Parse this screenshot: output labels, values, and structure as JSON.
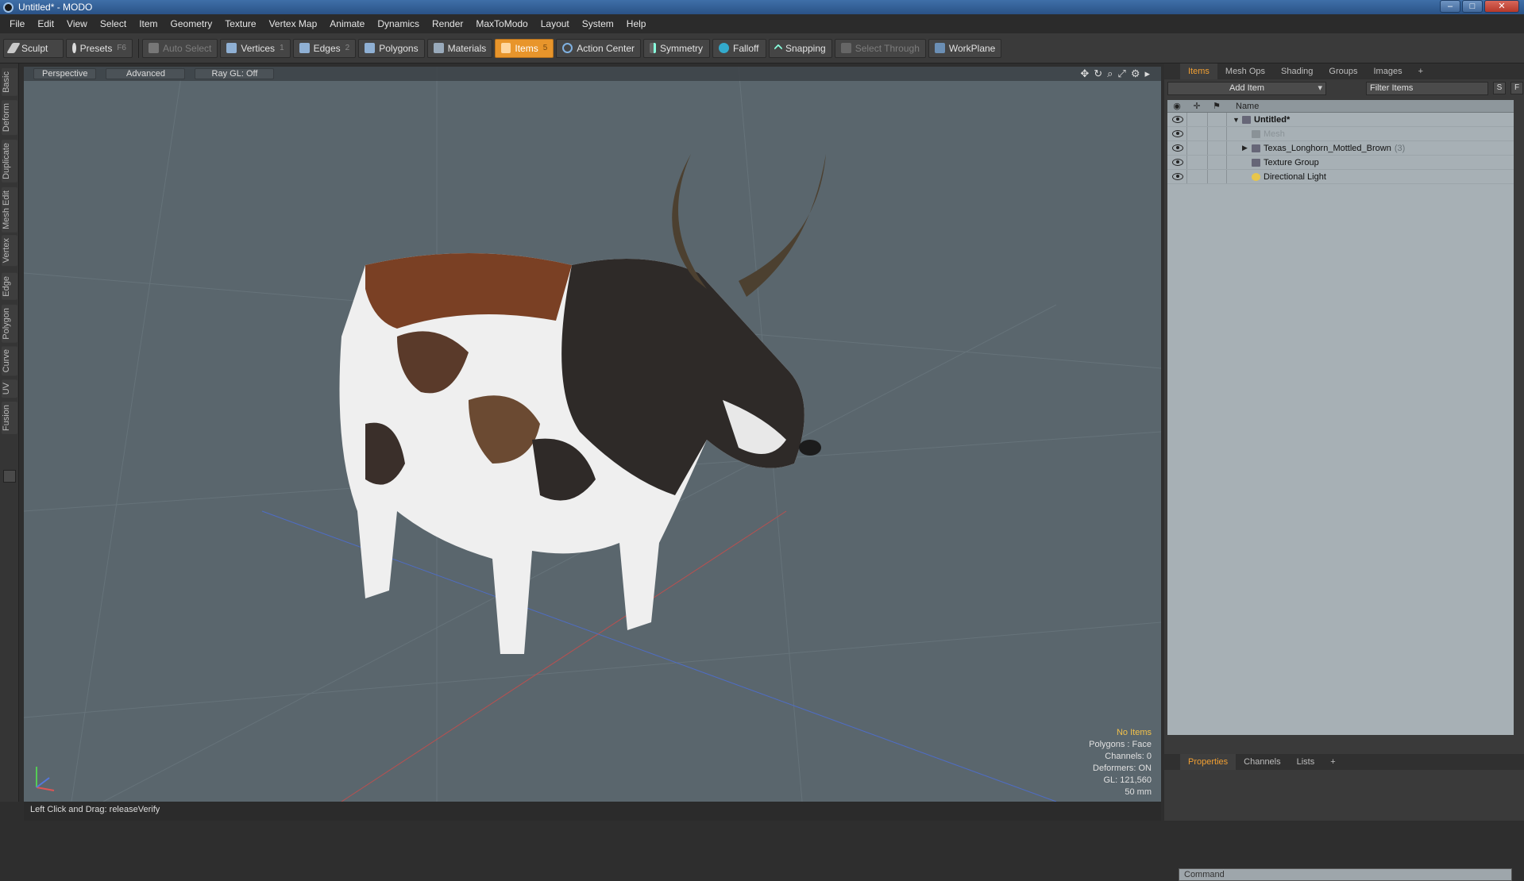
{
  "window": {
    "title": "Untitled* - MODO",
    "minimize": "–",
    "maximize": "□",
    "close": "✕"
  },
  "menu": [
    "File",
    "Edit",
    "View",
    "Select",
    "Item",
    "Geometry",
    "Texture",
    "Vertex Map",
    "Animate",
    "Dynamics",
    "Render",
    "MaxToModo",
    "Layout",
    "System",
    "Help"
  ],
  "toolbar": {
    "sculpt": "Sculpt",
    "presets": "Presets",
    "presets_key": "F6",
    "auto_select": "Auto Select",
    "vertices": "Vertices",
    "vertices_key": "1",
    "edges": "Edges",
    "edges_key": "2",
    "polygons": "Polygons",
    "materials": "Materials",
    "items": "Items",
    "items_key": "5",
    "action_center": "Action Center",
    "symmetry": "Symmetry",
    "falloff": "Falloff",
    "snapping": "Snapping",
    "select_through": "Select Through",
    "workplane": "WorkPlane"
  },
  "left_tabs": [
    "Basic",
    "Deform",
    "Duplicate",
    "Mesh Edit",
    "Vertex",
    "Edge",
    "Polygon",
    "Curve",
    "UV",
    "Fusion"
  ],
  "viewport": {
    "perspective": "Perspective",
    "advanced": "Advanced",
    "raygl": "Ray GL: Off",
    "hud": {
      "no_items": "No Items",
      "polygons": "Polygons : Face",
      "channels": "Channels: 0",
      "deformers": "Deformers: ON",
      "gl": "GL: 121,560",
      "scale": "50 mm"
    }
  },
  "status": {
    "text": "Left Click and Drag:  releaseVerify"
  },
  "items_panel": {
    "tabs": [
      "Items",
      "Mesh Ops",
      "Shading",
      "Groups",
      "Images",
      "+"
    ],
    "add_item": "Add Item",
    "filter": "Filter Items",
    "s_btn": "S",
    "f_btn": "F",
    "col_name": "Name",
    "tree": {
      "scene": "Untitled*",
      "mesh": "Mesh",
      "model": "Texas_Longhorn_Mottled_Brown",
      "model_count": "(3)",
      "texture_group": "Texture Group",
      "light": "Directional Light"
    }
  },
  "props_panel": {
    "tabs": [
      "Properties",
      "Channels",
      "Lists",
      "+"
    ],
    "command": "Command"
  },
  "colors": {
    "accent": "#e8952b",
    "viewport_bg": "#5a666d",
    "tree_bg": "#a7b0b5"
  }
}
